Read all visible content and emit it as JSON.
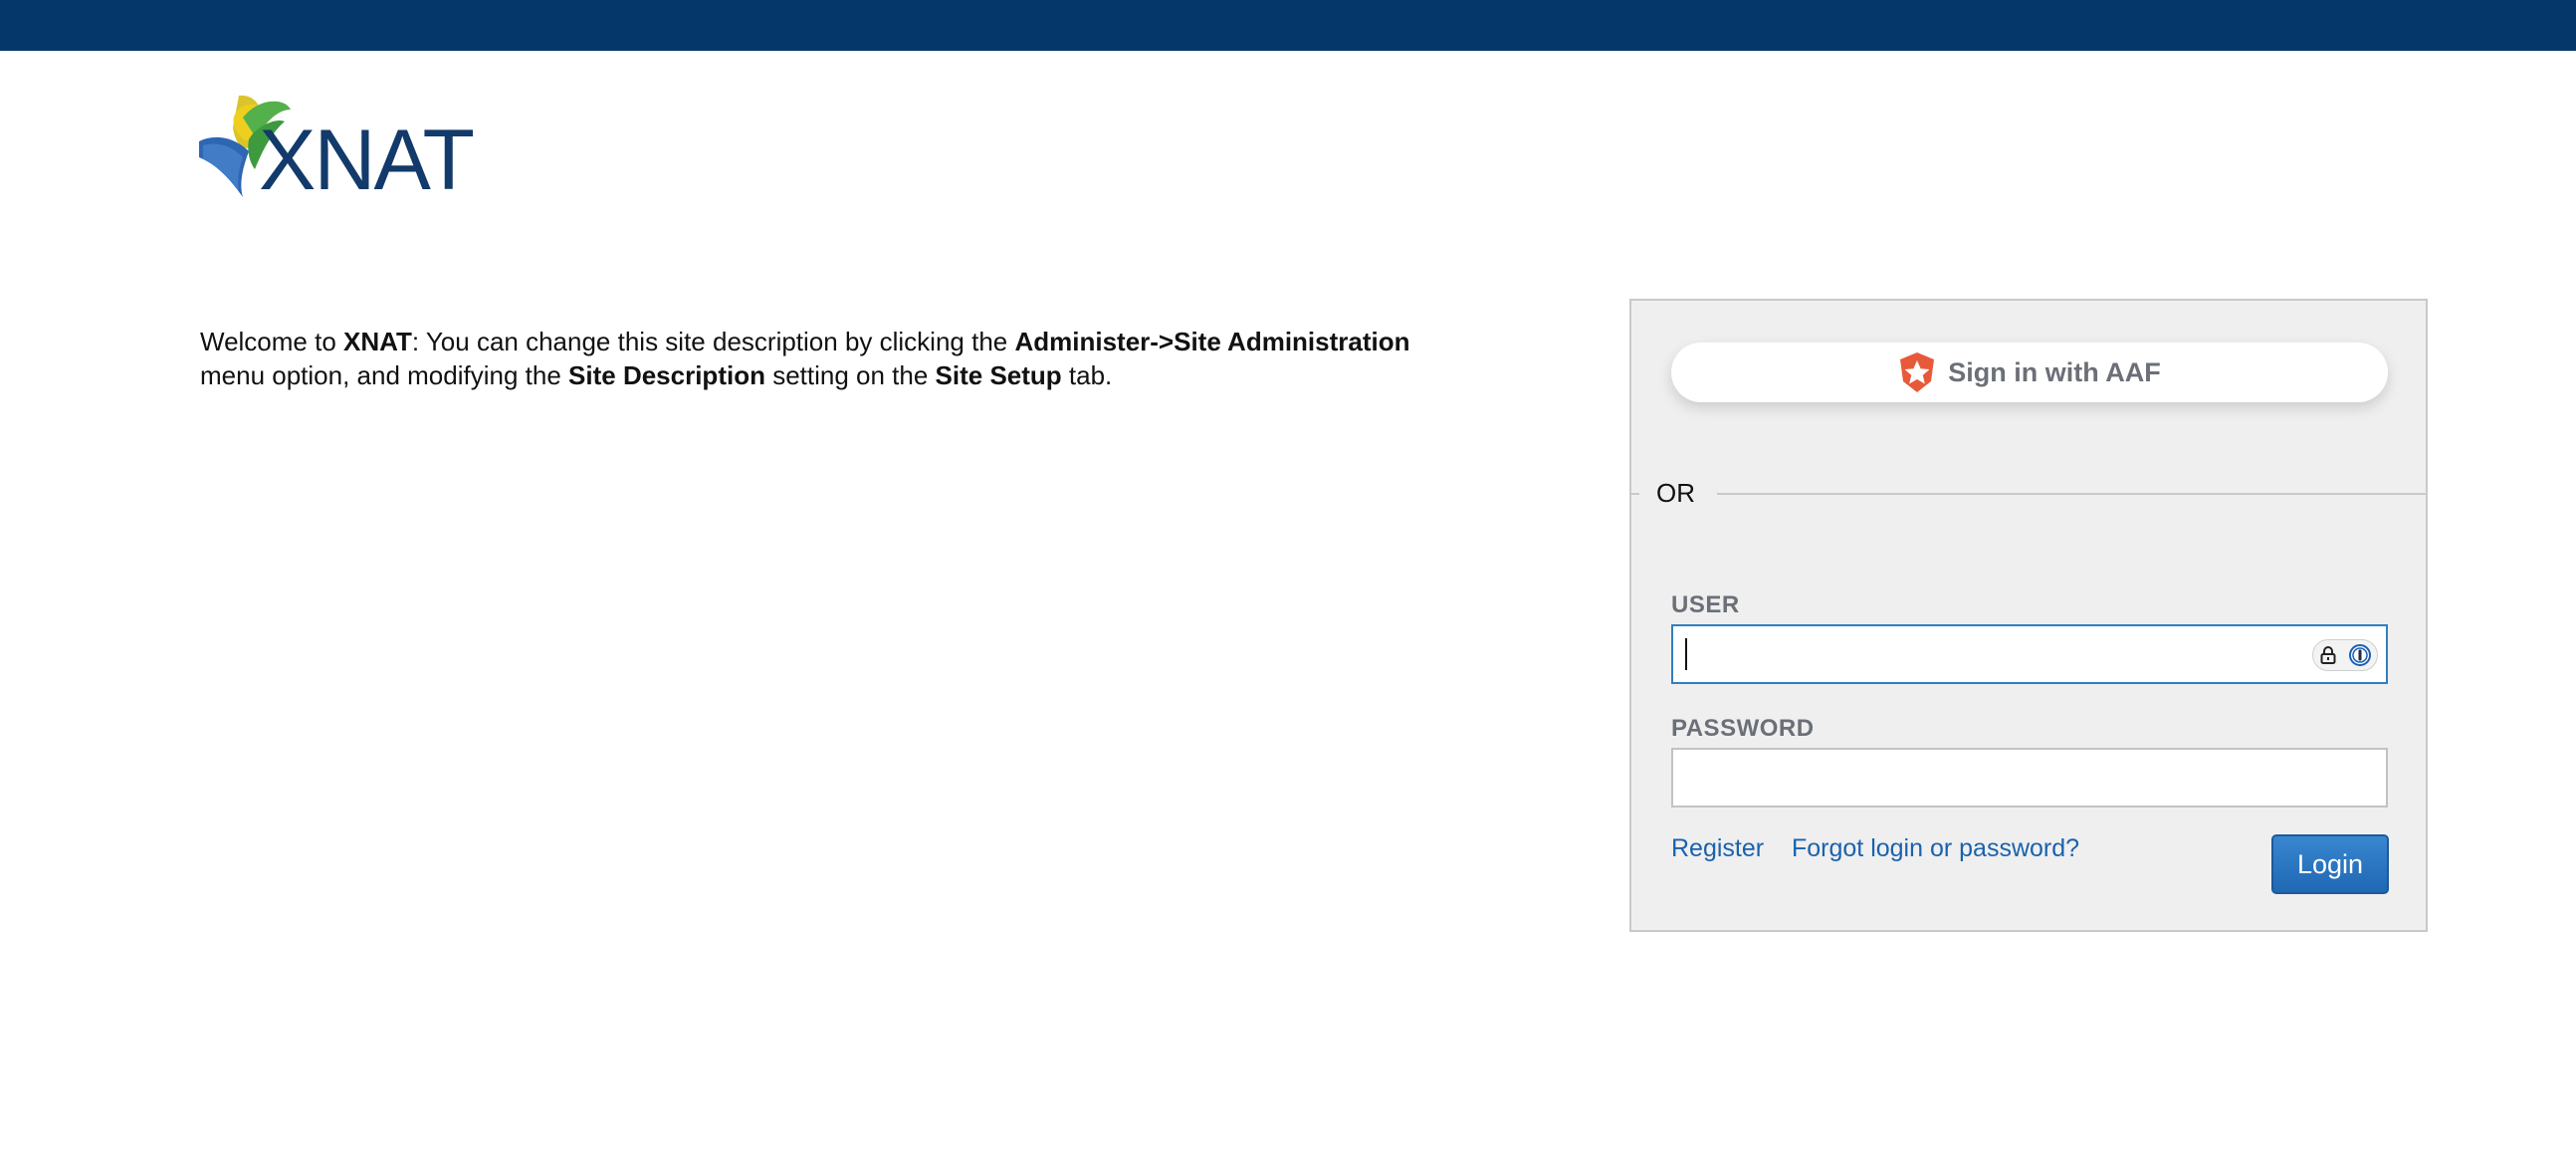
{
  "header": {
    "logo_text": "XNAT",
    "bar_color": "#05376b"
  },
  "welcome": {
    "part1": "Welcome to ",
    "app_name": "XNAT",
    "part2": ": You can change this site description by clicking the ",
    "menu_path": "Administer->Site Administration",
    "part3": " menu option, and modifying the ",
    "setting_name": "Site Description",
    "part4": " setting on the ",
    "tab_name": "Site Setup",
    "part5": " tab."
  },
  "login": {
    "aaf_label": "Sign in with AAF",
    "aaf_icon": "aaf-star-shield-icon",
    "or_label": "OR",
    "user_label": "USER",
    "user_value": "",
    "password_label": "PASSWORD",
    "password_value": "",
    "password_manager_icons": [
      "lock-icon",
      "1password-icon"
    ],
    "register_link": "Register",
    "forgot_link": "Forgot login or password?",
    "login_button": "Login"
  },
  "colors": {
    "accent": "#1f68b4",
    "link": "#1a62ad",
    "aaf_orange": "#e8593a",
    "panel_bg": "#efefef"
  }
}
